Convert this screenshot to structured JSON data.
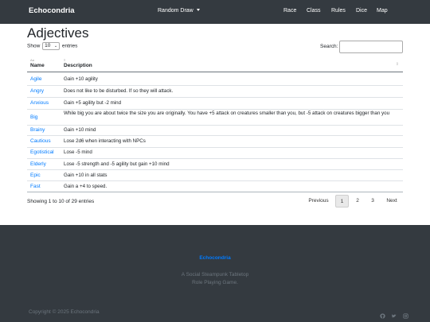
{
  "navbar": {
    "brand": "Echocondria",
    "dropdown_label": "Random Draw",
    "links": [
      "Race",
      "Class",
      "Rules",
      "Dice",
      "Map"
    ]
  },
  "page": {
    "title": "Adjectives",
    "length_prefix": "Show",
    "length_value": "10",
    "length_suffix": "entries",
    "search_label": "Search:"
  },
  "table": {
    "columns": [
      "Name",
      "Description"
    ],
    "rows": [
      {
        "name": "Agile",
        "description": "Gain +10 agility"
      },
      {
        "name": "Angry",
        "description": "Does not like to be disturbed. If so they will attack."
      },
      {
        "name": "Anxious",
        "description": "Gain +5 agility but -2 mind"
      },
      {
        "name": "Big",
        "description": "While big you are about twice the size you are originally. You have +5 attack on creatures smaller than you, but -5 attack on creatures bigger than you"
      },
      {
        "name": "Brainy",
        "description": "Gain +10 mind"
      },
      {
        "name": "Cautious",
        "description": "Lose 2d6 when interacting with NPCs"
      },
      {
        "name": "Egotistical",
        "description": "Lose -5 mind"
      },
      {
        "name": "Elderly",
        "description": "Lose -5 strength and -5 agility but gain +10 mind"
      },
      {
        "name": "Epic",
        "description": "Gain +10 in all stats"
      },
      {
        "name": "Fast",
        "description": "Gain a +4 to speed."
      }
    ]
  },
  "pagination": {
    "info": "Showing 1 to 10 of 29 entries",
    "previous": "Previous",
    "pages": [
      "1",
      "2",
      "3"
    ],
    "active_page": "1",
    "next": "Next"
  },
  "footer": {
    "brand": "Echocondria",
    "tagline_line1": "A Social Steampunk Tabletop",
    "tagline_line2": "Role Playing Game.",
    "copyright": "Copyright © 2025 Echocondria",
    "icons": [
      "github-icon",
      "twitter-icon",
      "instagram-icon"
    ]
  },
  "colors": {
    "navbar_bg": "#343a40",
    "link": "#007bff",
    "footer_text": "#6c757d"
  }
}
